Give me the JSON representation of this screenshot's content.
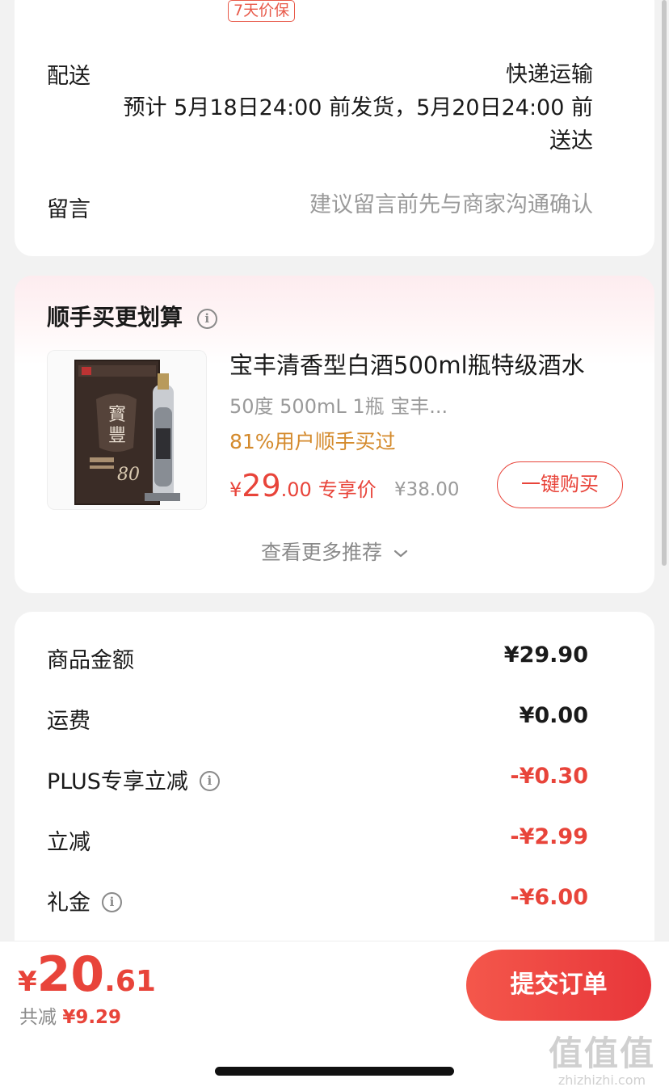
{
  "delivery_card": {
    "badge": "7天价保",
    "delivery_label": "配送",
    "delivery_method": "快递运输",
    "delivery_line1": "预计 5月18日24:00 前发货，5月20日24:00 前",
    "delivery_line2": "送达",
    "note_label": "留言",
    "note_placeholder": "建议留言前先与商家沟通确认"
  },
  "recommend_card": {
    "title": "顺手买更划算",
    "product": {
      "name": "宝丰清香型白酒500ml瓶特级酒水",
      "spec": "50度 500mL 1瓶 宝丰...",
      "buy_rate": "81%用户顺手买过",
      "price_yen": "¥",
      "price_int": "29",
      "price_dec": ".00",
      "price_tag": "专享价",
      "original_price": "¥38.00",
      "buy_button": "一键购买"
    },
    "more_label": "查看更多推荐"
  },
  "summary_card": {
    "rows": [
      {
        "label": "商品金额",
        "value": "¥29.90",
        "info": false,
        "red": false
      },
      {
        "label": "运费",
        "value": "¥0.00",
        "info": false,
        "red": false
      },
      {
        "label": "PLUS专享立减",
        "value": "-¥0.30",
        "info": true,
        "red": true
      },
      {
        "label": "立减",
        "value": "-¥2.99",
        "info": false,
        "red": true
      },
      {
        "label": "礼金",
        "value": "-¥6.00",
        "info": true,
        "red": true
      }
    ]
  },
  "bottom_bar": {
    "total_yen": "¥",
    "total_int": "20",
    "total_dec": ".61",
    "saved_label": "共减",
    "saved_amount": "¥9.29",
    "submit_label": "提交订单"
  },
  "watermark": {
    "logo": "值值值",
    "site": "zhizhizhi.com"
  },
  "colors": {
    "accent_red": "#e8443a",
    "orange_text": "#d48a2c",
    "muted_text": "#9a9a9a",
    "background": "#f2f2f2"
  },
  "icons": {
    "info": "info-circle-icon",
    "more": "chevron-down-icon"
  }
}
